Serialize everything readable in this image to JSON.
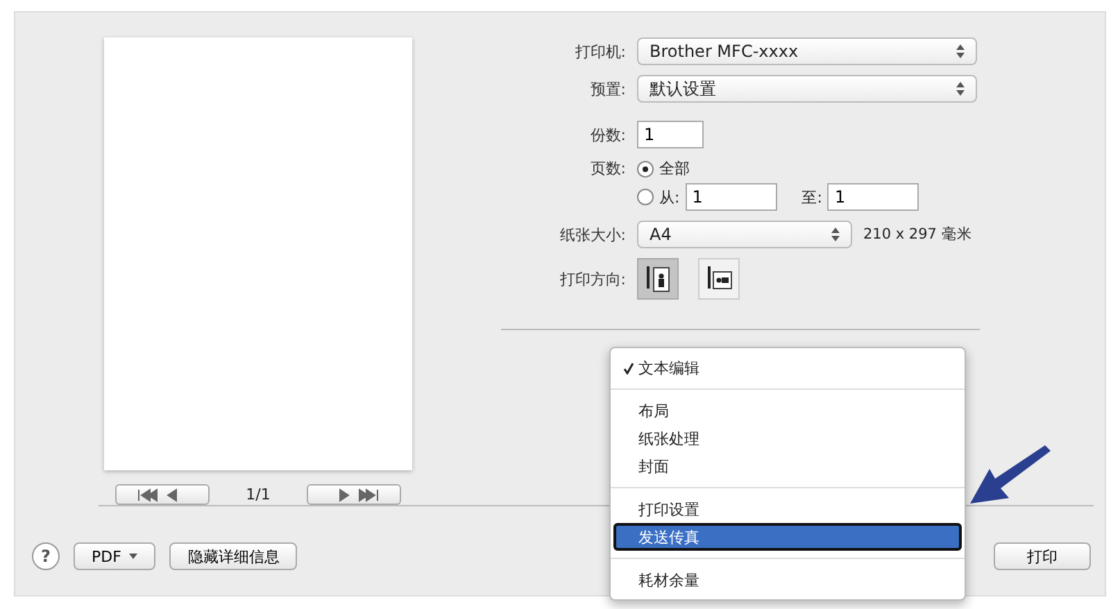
{
  "printer": {
    "label": "打印机:",
    "value": "Brother MFC-xxxx"
  },
  "presets": {
    "label": "预置:",
    "value": "默认设置"
  },
  "copies": {
    "label": "份数:",
    "value": "1"
  },
  "pages": {
    "label": "页数:",
    "options": [
      {
        "kind": "all",
        "label": "全部",
        "selected": true
      },
      {
        "kind": "range",
        "label": "从:",
        "selected": false,
        "from": "1",
        "to_label": "至:",
        "to": "1"
      }
    ]
  },
  "paper_size": {
    "label": "纸张大小:",
    "value": "A4",
    "dimensions": "210 x 297 毫米"
  },
  "orientation": {
    "label": "打印方向:",
    "options": [
      {
        "kind": "portrait",
        "selected": true
      },
      {
        "kind": "landscape",
        "selected": false
      }
    ]
  },
  "preview": {
    "page_indicator": "1/1"
  },
  "menu": {
    "sections": [
      [
        {
          "label": "文本编辑",
          "checked": true,
          "selected": false
        }
      ],
      [
        {
          "label": "布局",
          "checked": false,
          "selected": false
        },
        {
          "label": "纸张处理",
          "checked": false,
          "selected": false
        },
        {
          "label": "封面",
          "checked": false,
          "selected": false
        }
      ],
      [
        {
          "label": "打印设置",
          "checked": false,
          "selected": false
        },
        {
          "label": "发送传真",
          "checked": false,
          "selected": true
        }
      ],
      [
        {
          "label": "耗材余量",
          "checked": false,
          "selected": false
        }
      ]
    ]
  },
  "bottom": {
    "help": "?",
    "pdf": "PDF",
    "details_button": "隐藏详细信息",
    "print_button": "打印"
  }
}
